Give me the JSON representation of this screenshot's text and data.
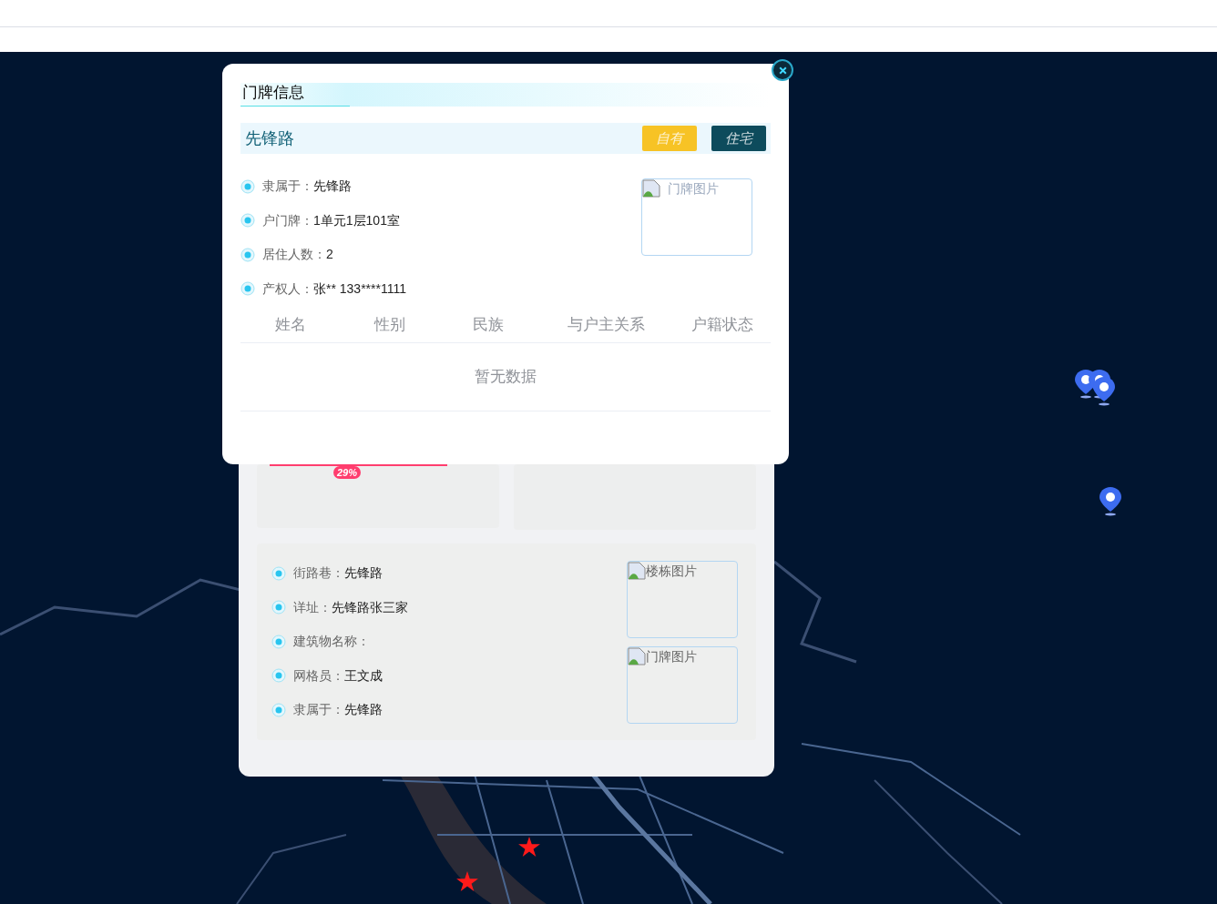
{
  "modal": {
    "title": "门牌信息",
    "header": {
      "name": "先锋路",
      "tags": [
        {
          "label": "自有",
          "color": "#f7c325"
        },
        {
          "label": "住宅",
          "color": "#0d4b5c"
        }
      ]
    },
    "fields": [
      {
        "label": "隶属于：",
        "value": "先锋路"
      },
      {
        "label": "户门牌：",
        "value": "1单元1层101室"
      },
      {
        "label": "居住人数：",
        "value": "2"
      },
      {
        "label": "产权人：",
        "value": "张** 133****1111"
      }
    ],
    "image_alt": "门牌图片",
    "table": {
      "columns": [
        "姓名",
        "性别",
        "民族",
        "与户主关系",
        "户籍状态"
      ],
      "empty_text": "暂无数据"
    }
  },
  "background_panel": {
    "badge": "29%",
    "fields": [
      {
        "label": "街路巷：",
        "value": "先锋路"
      },
      {
        "label": "详址：",
        "value": "先锋路张三家"
      },
      {
        "label": "建筑物名称："
      },
      {
        "label": "网格员：",
        "value": "王文成"
      },
      {
        "label": "隶属于：",
        "value": "先锋路"
      }
    ],
    "images": [
      "楼栋图片",
      "门牌图片"
    ]
  }
}
